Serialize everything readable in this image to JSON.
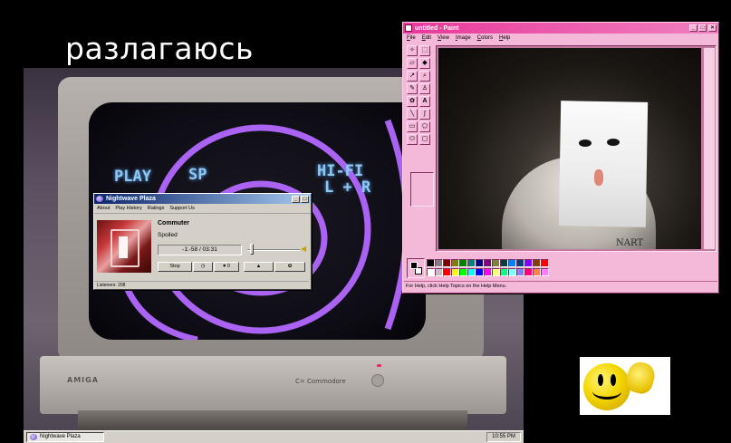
{
  "caption": "разлагаюсь",
  "crt": {
    "osd_play": "PLAY",
    "osd_sp": "SP",
    "osd_hifi": "HI-FI",
    "osd_lr": "L + R",
    "badge": "AMIGA",
    "brand": "C= Commodore",
    "screen_glow_color": "#b468ff"
  },
  "nightwave": {
    "title": "Nightwave Plaza",
    "menu": [
      "About",
      "Play History",
      "Ratings",
      "Support Us"
    ],
    "artist": "Commuter",
    "track": "Spoiled",
    "time": "-1:-58 / 03:31",
    "buttons": {
      "stop": "Stop",
      "history_icon": "clock-icon",
      "like_icon": "heart-icon",
      "like_count": "0",
      "user_icon": "user-icon",
      "settings_icon": "gear-icon"
    },
    "volume": 0.05,
    "status": "Listeners: 208",
    "title_color": "#0a246a"
  },
  "paint": {
    "title": "untitled - Paint",
    "menu": [
      "File",
      "Edit",
      "View",
      "Image",
      "Colors",
      "Help"
    ],
    "status": "For Help, click Help Topics on the Help Menu.",
    "canvas_text": "NART",
    "title_color": "#e83898",
    "palette_top": [
      "#000000",
      "#808080",
      "#800000",
      "#808000",
      "#008000",
      "#008080",
      "#000080",
      "#800080",
      "#808040",
      "#004040",
      "#0080ff",
      "#004080",
      "#8000ff",
      "#804000",
      "#ff0000"
    ],
    "palette_bottom": [
      "#ffffff",
      "#c0c0c0",
      "#ff0000",
      "#ffff00",
      "#00ff00",
      "#00ffff",
      "#0000ff",
      "#ff00ff",
      "#ffff80",
      "#00ff80",
      "#80ffff",
      "#8080ff",
      "#ff0080",
      "#ff8040",
      "#ff80ff"
    ]
  },
  "taskbar": {
    "task": "Nightwave Plaza",
    "clock": "10:55 PM"
  }
}
